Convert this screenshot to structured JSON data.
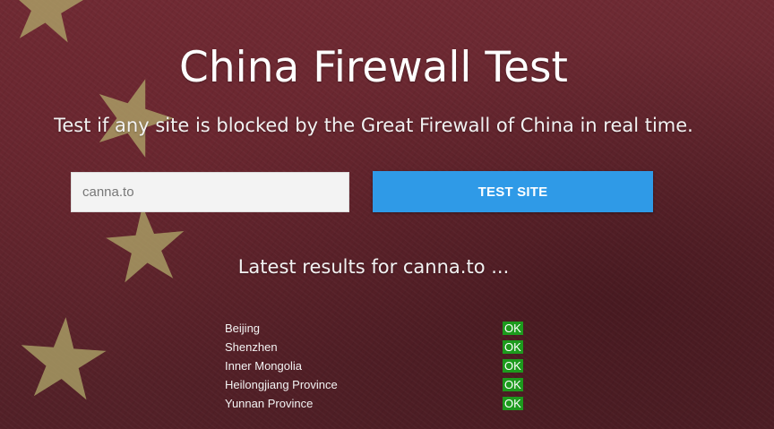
{
  "page": {
    "title": "China Firewall Test",
    "subtitle": "Test if any site is blocked by the Great Firewall of China in real time."
  },
  "form": {
    "site_value": "canna.to",
    "button_label": "TEST SITE"
  },
  "results": {
    "heading": "Latest results for canna.to ...",
    "rows": [
      {
        "location": "Beijing",
        "status": "OK"
      },
      {
        "location": "Shenzhen",
        "status": "OK"
      },
      {
        "location": "Inner Mongolia",
        "status": "OK"
      },
      {
        "location": "Heilongjiang Province",
        "status": "OK"
      },
      {
        "location": "Yunnan Province",
        "status": "OK"
      }
    ]
  },
  "colors": {
    "background": "#6e2a33",
    "star": "#b4b06e",
    "button": "#2f9ae7",
    "ok": "#1d9a1d"
  },
  "background_icons": [
    "star-icon",
    "star-icon",
    "star-icon",
    "star-icon",
    "star-icon"
  ]
}
